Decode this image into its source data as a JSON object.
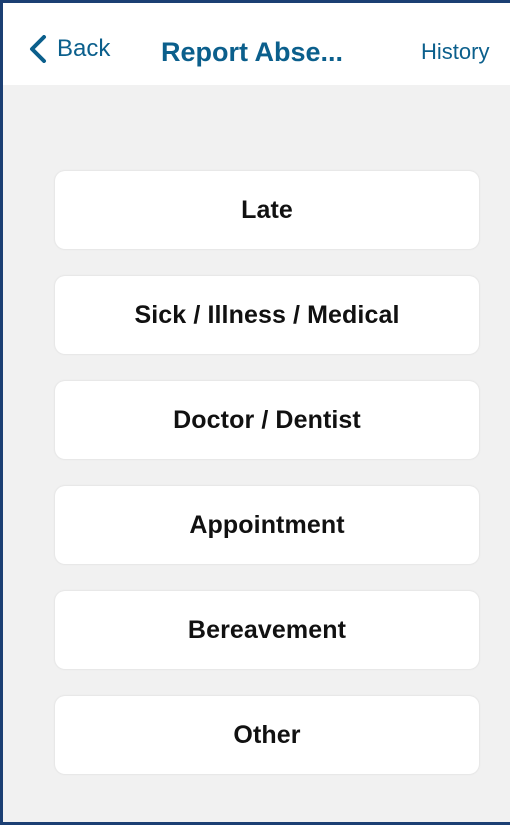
{
  "nav": {
    "back_icon": "chevron-left-icon",
    "back_label": "Back",
    "title": "Report Abse...",
    "history_label": "History"
  },
  "options": [
    {
      "label": "Late"
    },
    {
      "label": "Sick / Illness / Medical"
    },
    {
      "label": "Doctor / Dentist"
    },
    {
      "label": "Appointment"
    },
    {
      "label": "Bereavement"
    },
    {
      "label": "Other"
    }
  ],
  "colors": {
    "accent": "#0b5f8c",
    "frame": "#1b3f73",
    "background": "#f1f1f1",
    "text": "#111111"
  }
}
